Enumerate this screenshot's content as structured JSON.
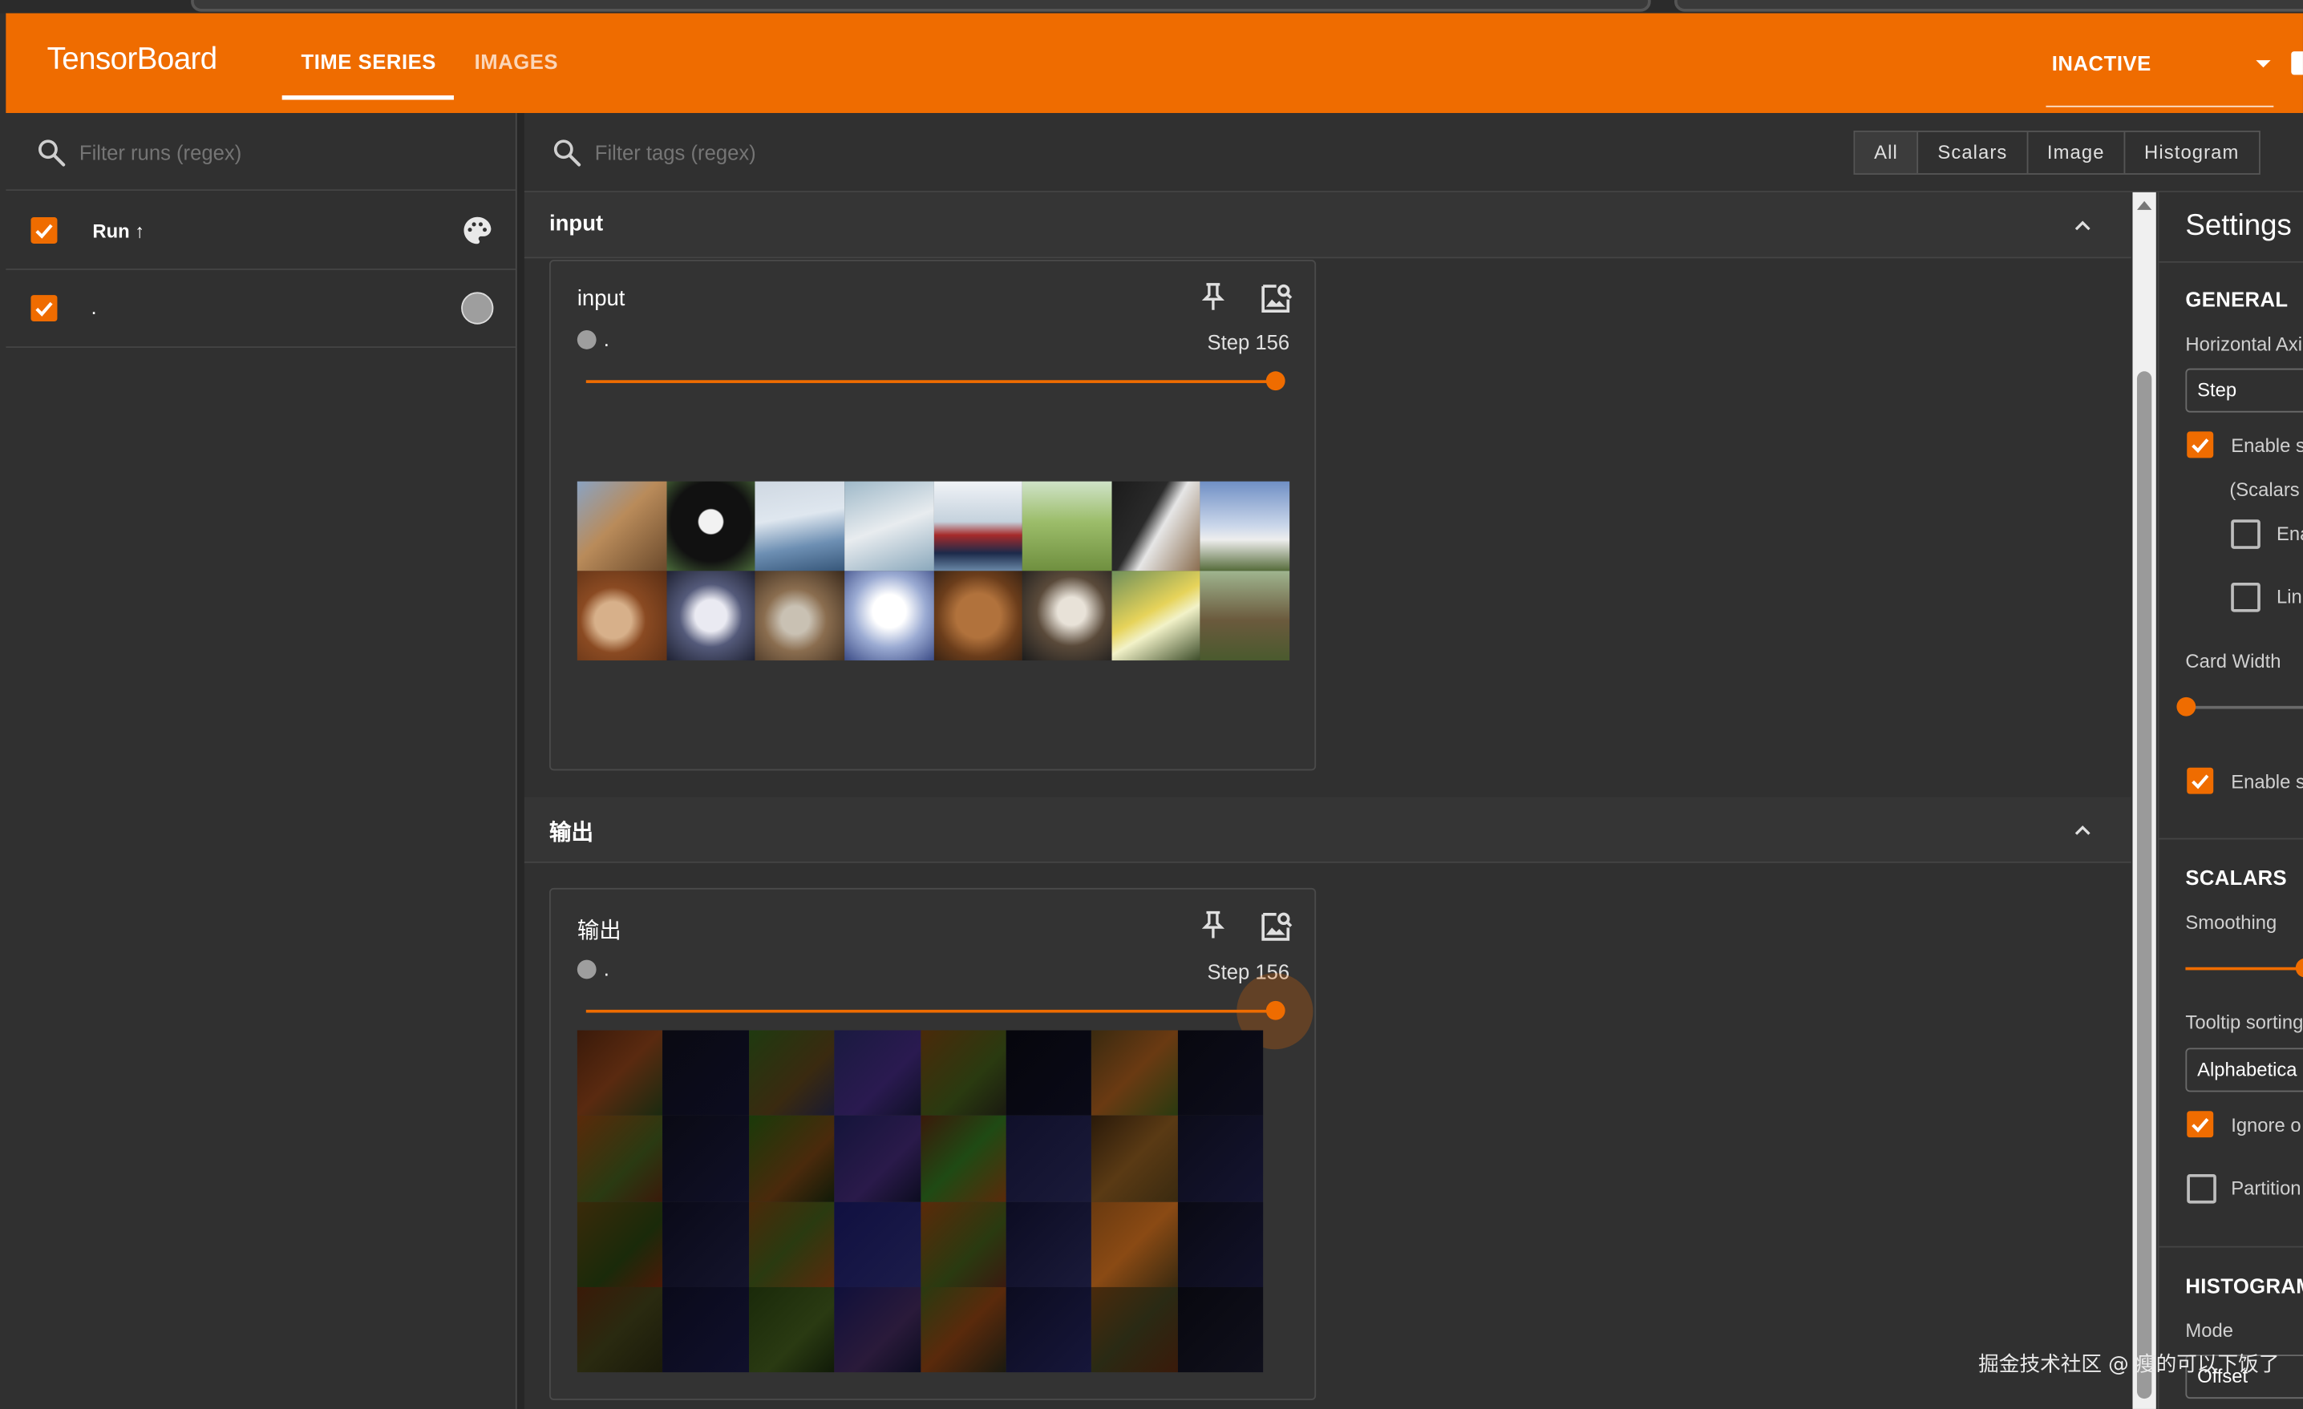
{
  "app": {
    "title": "TensorBoard"
  },
  "tabs": [
    {
      "label": "TIME SERIES",
      "active": true
    },
    {
      "label": "IMAGES",
      "active": false
    }
  ],
  "status": {
    "value": "INACTIVE"
  },
  "runs_panel": {
    "filter_placeholder": "Filter runs (regex)",
    "header_label": "Run ↑",
    "runs": [
      {
        "name": ".",
        "checked": true,
        "color": "#9e9e9e"
      }
    ]
  },
  "main": {
    "tag_filter_placeholder": "Filter tags (regex)",
    "type_filters": [
      "All",
      "Scalars",
      "Image",
      "Histogram"
    ],
    "selected_type": "All",
    "groups": [
      {
        "title": "input",
        "card": {
          "title": "input",
          "run_label": ".",
          "step_label": "Step 156",
          "slider_fraction": 1.0
        }
      },
      {
        "title": "输出",
        "card": {
          "title": "输出",
          "run_label": ".",
          "step_label": "Step 156",
          "slider_fraction": 1.0
        }
      }
    ]
  },
  "settings": {
    "title": "Settings",
    "general": {
      "heading": "GENERAL",
      "horizontal_axis_label": "Horizontal Axi",
      "horizontal_axis_value": "Step",
      "enable_step_selection": "Enable s",
      "scalars_note": "(Scalars",
      "sub_option_1": "Ena",
      "sub_option_2": "Lin",
      "card_width_label": "Card Width",
      "enable_2": "Enable s"
    },
    "scalars": {
      "heading": "SCALARS",
      "smoothing_label": "Smoothing",
      "tooltip_sorting_label": "Tooltip sorting",
      "tooltip_sorting_value": "Alphabetica",
      "ignore_outliers": "Ignore o",
      "partition": "Partition"
    },
    "histograms": {
      "heading": "HISTOGRAM",
      "mode_label": "Mode",
      "mode_value": "Offset"
    }
  },
  "watermark": "掘金技术社区 @ 瘦的可以下饭了",
  "colors": {
    "accent": "#ef6c00",
    "background": "#303030",
    "panel": "#333333"
  },
  "icons": {
    "search": "search-icon",
    "palette": "palette-icon",
    "pin": "pin-icon",
    "fullscreen_image": "image-search-icon",
    "collapse": "chevron-up-icon",
    "dropdown": "caret-down-icon"
  }
}
